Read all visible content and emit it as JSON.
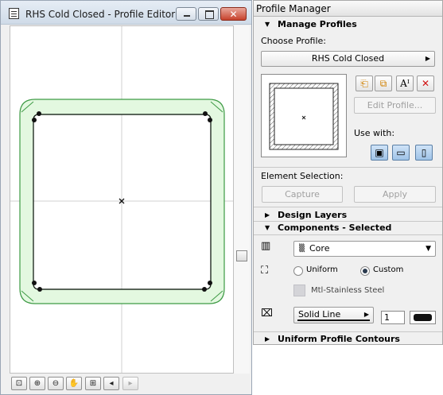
{
  "editor": {
    "title": "RHS Cold Closed - Profile Editor",
    "close_glyph": "✕",
    "zoom_tools": [
      {
        "name": "zoom-fit-icon",
        "glyph": "⊡"
      },
      {
        "name": "zoom-in-icon",
        "glyph": "⊕"
      },
      {
        "name": "zoom-out-icon",
        "glyph": "⊖"
      },
      {
        "name": "pan-hand-icon",
        "glyph": "✋"
      },
      {
        "name": "zoom-extents-icon",
        "glyph": "⊞"
      },
      {
        "name": "zoom-previous-icon",
        "glyph": "◂"
      },
      {
        "name": "zoom-next-icon",
        "glyph": "▸"
      }
    ]
  },
  "manager": {
    "title": "Profile Manager",
    "manage_profiles": "Manage Profiles",
    "choose_profile_label": "Choose Profile:",
    "profile_value": "RHS Cold Closed",
    "edit_profile": "Edit Profile...",
    "use_with_label": "Use with:",
    "element_selection_label": "Element Selection:",
    "capture": "Capture",
    "apply": "Apply",
    "design_layers": "Design Layers",
    "components_selected": "Components - Selected",
    "component_value": "Core",
    "uniform": "Uniform",
    "custom": "Custom",
    "material": "Mtl-Stainless Steel",
    "line_type": "Solid Line",
    "pen_number": "1",
    "uniform_contours": "Uniform Profile Contours"
  },
  "colors": {
    "profile_fill": "#e3f8e0",
    "profile_stroke": "#3d9a44",
    "inner_stroke": "#1a1a1a"
  }
}
